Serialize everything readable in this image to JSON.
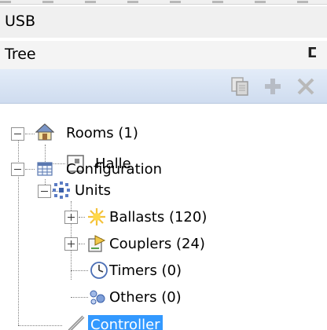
{
  "window": {
    "usb_label": "USB"
  },
  "panel": {
    "title": "Tree",
    "pin_glyph": "ⵎ"
  },
  "toolbar": {
    "buttons": [
      {
        "icon": "copy-icon",
        "enabled": false
      },
      {
        "icon": "add-icon",
        "enabled": false
      },
      {
        "icon": "delete-icon",
        "enabled": false
      }
    ]
  },
  "tree": {
    "rooms": {
      "label": "Rooms (1)",
      "icon": "house-icon",
      "expanded": true
    },
    "halle": {
      "label": "Halle",
      "icon": "room-icon"
    },
    "configuration": {
      "label": "Configuration",
      "icon": "table-icon",
      "expanded": true
    },
    "units": {
      "label": "Units",
      "icon": "network-icon",
      "expanded": true
    },
    "ballasts": {
      "label": "Ballasts (120)",
      "icon": "sun-icon",
      "expanded": false
    },
    "couplers": {
      "label": "Couplers (24)",
      "icon": "coupler-icon",
      "expanded": false
    },
    "timers": {
      "label": "Timers (0)",
      "icon": "clock-icon"
    },
    "others": {
      "label": "Others (0)",
      "icon": "others-icon"
    },
    "controller": {
      "label": "Controller",
      "icon": "controller-icon",
      "selected": true
    }
  },
  "colors": {
    "selection": "#3399ff",
    "toolbar": "#d8e4f3"
  }
}
